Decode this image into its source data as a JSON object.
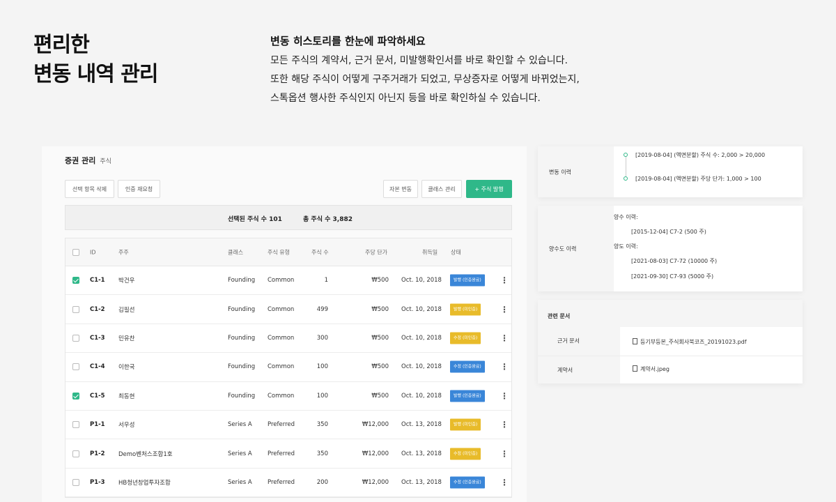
{
  "hero": {
    "title_line1": "편리한",
    "title_line2": "변동 내역 관리",
    "heading": "변동 히스토리를 한눈에 파악하세요",
    "lines": [
      "모든 주식의 계약서, 근거 문서, 미발행확인서를 바로 확인할 수 있습니다.",
      "또한 해당 주식이 어떻게 구주거래가 되었고, 무상증자로 어떻게 바뀌었는지,",
      "스톡옵션 행사한 주식인지 아닌지 등을 바로 확인하실 수 있습니다."
    ]
  },
  "panel": {
    "title": "증권 관리",
    "subtitle": "주식",
    "buttons": {
      "delete_selected": "선택 항목 삭제",
      "request_auth": "인증 재요청",
      "capital_change": "자본 변동",
      "class_manage": "클래스 관리",
      "issue_stock": "+ 주식 발행"
    },
    "summary": {
      "selected": "선택된 주식 수  101",
      "total": "총 주식 수  3,882"
    },
    "table": {
      "headers": [
        "ID",
        "주주",
        "클래스",
        "주식 유형",
        "주식 수",
        "주당 단가",
        "취득일",
        "상태"
      ],
      "rows": [
        {
          "checked": true,
          "id": "C1-1",
          "holder": "박건우",
          "class": "Founding",
          "type": "Common",
          "shares": "1",
          "price": "₩500",
          "date": "Oct. 10, 2018",
          "status": "발행 (인증완료)",
          "status_color": "blue"
        },
        {
          "checked": false,
          "id": "C1-2",
          "holder": "김필선",
          "class": "Founding",
          "type": "Common",
          "shares": "499",
          "price": "₩500",
          "date": "Oct. 10, 2018",
          "status": "발행 (미인증)",
          "status_color": "yellow"
        },
        {
          "checked": false,
          "id": "C1-3",
          "holder": "민유찬",
          "class": "Founding",
          "type": "Common",
          "shares": "300",
          "price": "₩500",
          "date": "Oct. 10, 2018",
          "status": "수정 (미인증)",
          "status_color": "yellow"
        },
        {
          "checked": false,
          "id": "C1-4",
          "holder": "이한국",
          "class": "Founding",
          "type": "Common",
          "shares": "100",
          "price": "₩500",
          "date": "Oct. 10, 2018",
          "status": "수정 (인증완료)",
          "status_color": "blue"
        },
        {
          "checked": true,
          "id": "C1-5",
          "holder": "최동현",
          "class": "Founding",
          "type": "Common",
          "shares": "100",
          "price": "₩500",
          "date": "Oct. 10, 2018",
          "status": "발행 (인증완료)",
          "status_color": "blue"
        },
        {
          "checked": false,
          "id": "P1-1",
          "holder": "서우성",
          "class": "Series A",
          "type": "Preferred",
          "shares": "350",
          "price": "₩12,000",
          "date": "Oct. 13, 2018",
          "status": "발행 (미인증)",
          "status_color": "yellow"
        },
        {
          "checked": false,
          "id": "P1-2",
          "holder": "Demo벤처스조합1호",
          "class": "Series A",
          "type": "Preferred",
          "shares": "350",
          "price": "₩12,000",
          "date": "Oct. 13, 2018",
          "status": "수정 (미인증)",
          "status_color": "yellow"
        },
        {
          "checked": false,
          "id": "P1-3",
          "holder": "HB청년창업투자조합",
          "class": "Series A",
          "type": "Preferred",
          "shares": "200",
          "price": "₩12,000",
          "date": "Oct. 13, 2018",
          "status": "수정 (인증완료)",
          "status_color": "blue"
        }
      ]
    }
  },
  "change_history": {
    "label": "변동 이력",
    "entries": [
      "[2019-08-04] (액면분할) 주식 수:  2,000 >  20,000",
      "[2019-08-04] (액면분할) 주당 단가:  1,000 >  100"
    ]
  },
  "transfer_history": {
    "label": "양수도 이력",
    "acquire_label": "양수 이력:",
    "acquire": [
      "[2015-12-04] C7-2 (500 주)"
    ],
    "transfer_label": "양도 이력:",
    "transfer": [
      "[2021-08-03] C7-72 (10000 주)",
      "[2021-09-30] C7-93 (5000 주)"
    ]
  },
  "documents": {
    "title": "관련 문서",
    "rows": [
      {
        "label": "근거 문서",
        "file": "등기부등본_주식회사북코즈_20191023.pdf"
      },
      {
        "label": "계약서",
        "file": "계약서.jpeg"
      }
    ]
  },
  "colors": {
    "accent": "#2fb889",
    "badge_blue": "#3a86d8",
    "badge_yellow": "#e8bb2a"
  }
}
